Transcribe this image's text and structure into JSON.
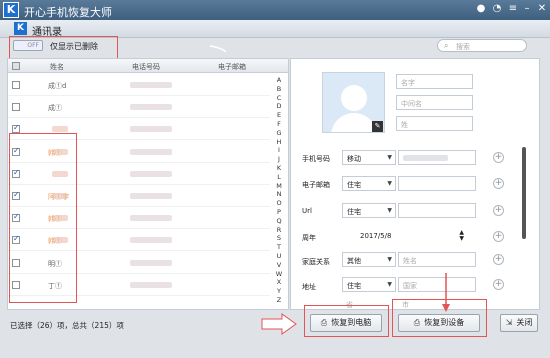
{
  "app": {
    "title": "开心手机恢复大师",
    "logo": "K"
  },
  "window_controls": [
    "wechat-icon",
    "chat-icon",
    "menu-icon",
    "minimize-icon",
    "close-icon"
  ],
  "module": {
    "title": "通讯录",
    "logo": "K"
  },
  "filter": {
    "toggle_state": "OFF",
    "label": "仅显示已删除"
  },
  "search": {
    "placeholder": "搜索"
  },
  "table": {
    "columns": [
      "姓名",
      "电话号码",
      "电子邮箱"
    ],
    "rows": [
      {
        "name": "成ⓕd",
        "checked": false,
        "highlight": false
      },
      {
        "name": "成ⓕ",
        "checked": false,
        "highlight": false
      },
      {
        "name": "",
        "checked": true,
        "highlight": true
      },
      {
        "name": "韩ⓕ",
        "checked": true,
        "highlight": true
      },
      {
        "name": "",
        "checked": true,
        "highlight": true
      },
      {
        "name": "阿ⓕ宇",
        "checked": true,
        "highlight": true
      },
      {
        "name": "韩ⓕ",
        "checked": true,
        "highlight": true
      },
      {
        "name": "韩ⓕ",
        "checked": true,
        "highlight": true
      },
      {
        "name": "明ⓕ",
        "checked": false,
        "highlight": false
      },
      {
        "name": "丁ⓕ",
        "checked": false,
        "highlight": false
      }
    ],
    "alphabet": [
      "A",
      "B",
      "C",
      "D",
      "E",
      "F",
      "G",
      "H",
      "I",
      "J",
      "K",
      "L",
      "M",
      "N",
      "O",
      "P",
      "Q",
      "R",
      "S",
      "T",
      "U",
      "V",
      "W",
      "X",
      "Y",
      "Z"
    ]
  },
  "status": "已选择（26）项，总共（215）项",
  "detail": {
    "name_placeholder": "名字",
    "middle_placeholder": "中间名",
    "last_placeholder": "姓",
    "phone_label": "手机号码",
    "phone_type": "移动",
    "email_label": "电子邮箱",
    "email_type": "住宅",
    "url_label": "Url",
    "url_type": "住宅",
    "birthday_label": "周年",
    "birthday_value": "2017/5/8",
    "family_label": "家庭关系",
    "family_type": "其他",
    "family_placeholder": "姓名",
    "address_label": "地址",
    "address_type": "住宅",
    "country_placeholder": "国家",
    "extra_placeholder1": "省",
    "extra_placeholder2": "市"
  },
  "buttons": {
    "restore_pc": "恢复到电脑",
    "restore_device": "恢复到设备",
    "close": "关闭"
  },
  "colors": {
    "accent": "#1e6fd0",
    "highlight_name": "#f0a060",
    "annotation": "#e05555"
  }
}
